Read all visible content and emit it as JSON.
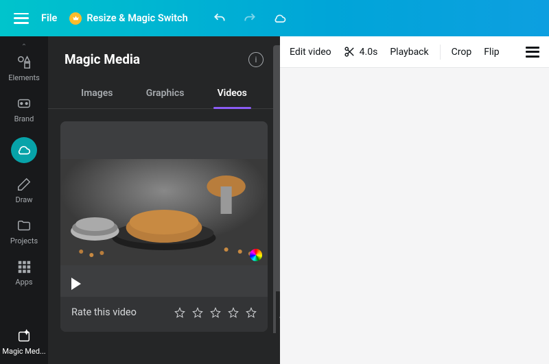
{
  "topbar": {
    "file": "File",
    "resize": "Resize & Magic Switch"
  },
  "sidebar": {
    "items": [
      {
        "label": "Elements"
      },
      {
        "label": "Brand"
      },
      {
        "label": ""
      },
      {
        "label": "Draw"
      },
      {
        "label": "Projects"
      },
      {
        "label": "Apps"
      }
    ],
    "bottom": {
      "label": "Magic Med..."
    }
  },
  "panel": {
    "title": "Magic Media",
    "tabs": [
      "Images",
      "Graphics",
      "Videos"
    ],
    "activeTab": 2,
    "rateLabel": "Rate this video"
  },
  "canvasbar": {
    "edit": "Edit video",
    "duration": "4.0s",
    "playback": "Playback",
    "crop": "Crop",
    "flip": "Flip"
  }
}
